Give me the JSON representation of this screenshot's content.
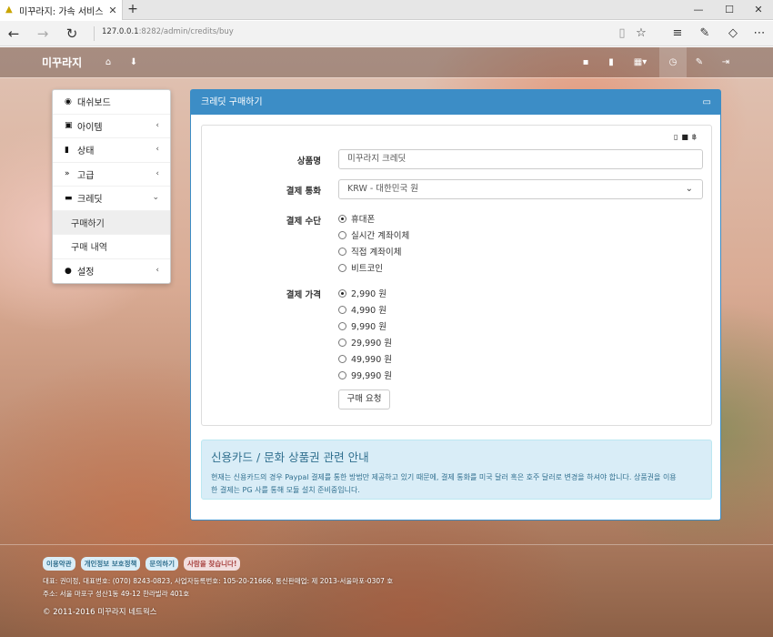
{
  "browser": {
    "tab_title": "미꾸라지: 가속 서비스",
    "url_host": "127.0.0.1",
    "url_path": ":8282/admin/credits/buy"
  },
  "site": {
    "brand": "미꾸라지"
  },
  "sidebar": {
    "items": [
      {
        "label": "대쉬보드",
        "icon": "dashboard-icon"
      },
      {
        "label": "아이템",
        "icon": "gift-icon"
      },
      {
        "label": "상태",
        "icon": "bar-chart-icon"
      },
      {
        "label": "고급",
        "icon": "fast-forward-icon"
      },
      {
        "label": "크레딧",
        "icon": "credit-card-icon"
      },
      {
        "label": "설정",
        "icon": "user-icon"
      }
    ],
    "sub_items": [
      "구매하기",
      "구매 내역"
    ]
  },
  "panel": {
    "title": "크레딧 구매하기"
  },
  "form": {
    "product_label": "상품명",
    "product_value": "미꾸라지 크레딧",
    "currency_label": "결제 통화",
    "currency_value": "KRW - 대한민국 원",
    "method_label": "결제 수단",
    "methods": [
      "휴대폰",
      "실시간 계좌이체",
      "직접 계좌이체",
      "비트코인"
    ],
    "method_selected": 0,
    "price_label": "결제 가격",
    "prices": [
      "2,990 원",
      "4,990 원",
      "9,990 원",
      "29,990 원",
      "49,990 원",
      "99,990 원"
    ],
    "price_selected": 0,
    "submit_label": "구매 요청"
  },
  "notice": {
    "title": "신용카드 / 문화 상품권 관련 안내",
    "line1": "현재는 신용카드의 경우 Paypal 결제를 통한 방법만 제공하고 있기 때문에, 결제 통화를 미국 달러 혹은 호주 달러로 변경을 하셔야 합니다. 상품권을 이용",
    "line2": "한 결제는 PG 사를 통해 모듈 설치 준비중입니다."
  },
  "footer": {
    "links": [
      "이용약관",
      "개인정보 보호정책",
      "문의하기",
      "사람을 찾습니다!"
    ],
    "info1": "대표: 권미정, 대표번호: (070) 8243-0823, 사업자등록번호: 105-20-21666, 통신판매업: 제 2013-서울마포-0307 호",
    "info2": "주소: 서울 마포구 성산1동 49-12 한라빌라 401호",
    "copyright": "© 2011-2016 미꾸라지 네트웍스"
  },
  "colors": {
    "primary": "#3c8dc6",
    "info_bg": "#d9edf7",
    "info_text": "#31708f",
    "danger_bg": "#f2dede"
  }
}
